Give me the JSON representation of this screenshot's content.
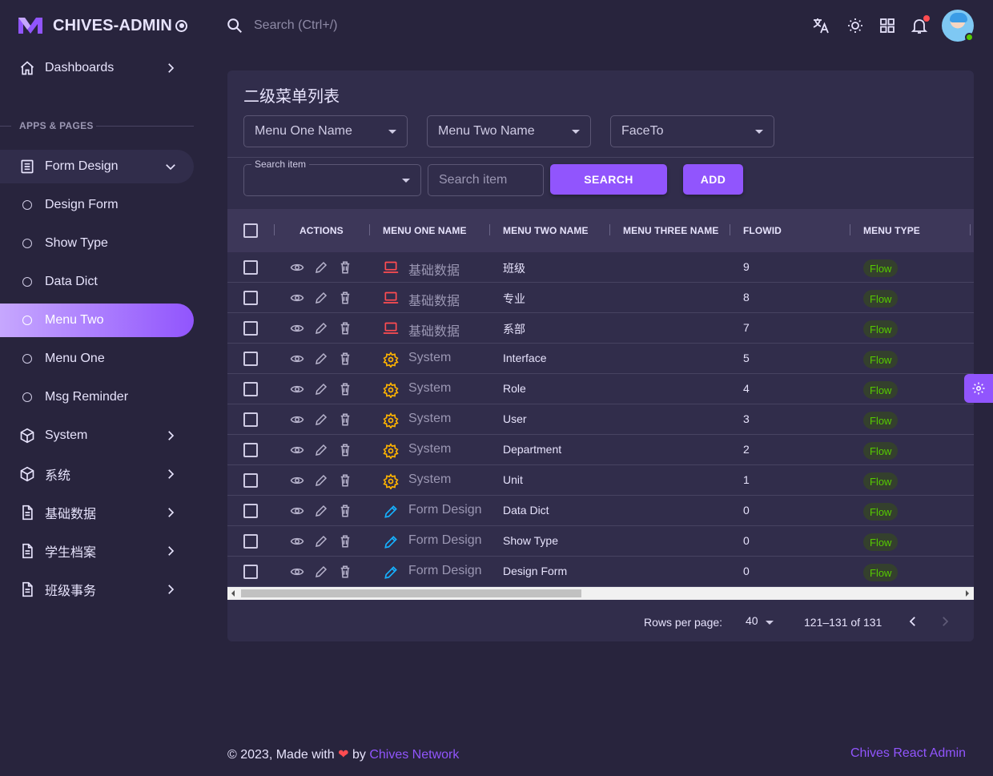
{
  "app": {
    "name": "CHIVES-ADMIN"
  },
  "sidebar": {
    "dashboards": "Dashboards",
    "section_label": "APPS & PAGES",
    "form_design": "Form Design",
    "sub_items": [
      "Design Form",
      "Show Type",
      "Data Dict",
      "Menu Two",
      "Menu One",
      "Msg Reminder"
    ],
    "active_sub": "Menu Two",
    "groups": [
      "System",
      "系统",
      "基础数据",
      "学生档案",
      "班级事务"
    ]
  },
  "topbar": {
    "search_placeholder": "Search (Ctrl+/)"
  },
  "page": {
    "title": "二级菜单列表",
    "filters": {
      "menu_one": "Menu One Name",
      "menu_two": "Menu Two Name",
      "faceto": "FaceTo"
    },
    "search_select_label": "Search item",
    "search_input_placeholder": "Search item",
    "search_button": "SEARCH",
    "add_button": "ADD"
  },
  "table": {
    "headers": [
      "ACTIONS",
      "MENU ONE NAME",
      "MENU TWO NAME",
      "MENU THREE NAME",
      "FLOWID",
      "MENU TYPE"
    ],
    "rows": [
      {
        "menu_one_icon": "laptop-icon",
        "menu_one": "基础数据",
        "menu_two": "班级",
        "flowid": "9",
        "type": "Flow"
      },
      {
        "menu_one_icon": "laptop-icon",
        "menu_one": "基础数据",
        "menu_two": "专业",
        "flowid": "8",
        "type": "Flow"
      },
      {
        "menu_one_icon": "laptop-icon",
        "menu_one": "基础数据",
        "menu_two": "系部",
        "flowid": "7",
        "type": "Flow"
      },
      {
        "menu_one_icon": "cog-icon",
        "menu_one": "System",
        "menu_two": "Interface",
        "flowid": "5",
        "type": "Flow"
      },
      {
        "menu_one_icon": "cog-icon",
        "menu_one": "System",
        "menu_two": "Role",
        "flowid": "4",
        "type": "Flow"
      },
      {
        "menu_one_icon": "cog-icon",
        "menu_one": "System",
        "menu_two": "User",
        "flowid": "3",
        "type": "Flow"
      },
      {
        "menu_one_icon": "cog-icon",
        "menu_one": "System",
        "menu_two": "Department",
        "flowid": "2",
        "type": "Flow"
      },
      {
        "menu_one_icon": "cog-icon",
        "menu_one": "System",
        "menu_two": "Unit",
        "flowid": "1",
        "type": "Flow"
      },
      {
        "menu_one_icon": "pencil-icon",
        "menu_one": "Form Design",
        "menu_two": "Data Dict",
        "flowid": "0",
        "type": "Flow"
      },
      {
        "menu_one_icon": "pencil-icon",
        "menu_one": "Form Design",
        "menu_two": "Show Type",
        "flowid": "0",
        "type": "Flow"
      },
      {
        "menu_one_icon": "pencil-icon",
        "menu_one": "Form Design",
        "menu_two": "Design Form",
        "flowid": "0",
        "type": "Flow"
      }
    ]
  },
  "pagination": {
    "rows_label": "Rows per page:",
    "rows_value": "40",
    "range": "121–131 of 131"
  },
  "footer": {
    "prefix": "© 2023, Made with",
    "by": "by",
    "network": "Chives Network",
    "right": "Chives React Admin"
  },
  "colors": {
    "primary": "#9155fd",
    "background": "#28243d",
    "card": "#312d4b",
    "success": "#56ca00",
    "danger": "#ff4c51",
    "warning": "#ffb400",
    "info": "#16b1ff"
  }
}
